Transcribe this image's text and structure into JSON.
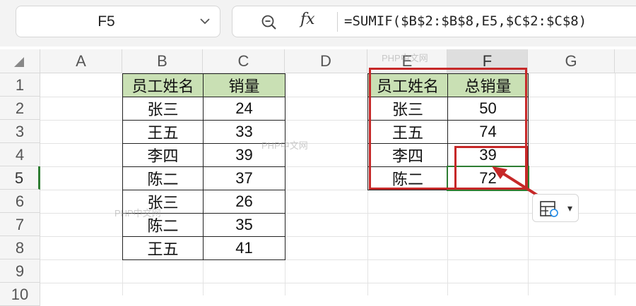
{
  "name_box": {
    "cell_ref": "F5"
  },
  "formula_bar": {
    "fx_label": "fx",
    "formula": "=SUMIF($B$2:$B$8,E5,$C$2:$C$8)"
  },
  "columns": [
    "A",
    "B",
    "C",
    "D",
    "E",
    "F",
    "G"
  ],
  "rows": [
    "1",
    "2",
    "3",
    "4",
    "5",
    "6",
    "7",
    "8",
    "9",
    "10"
  ],
  "selected_cell": "F5",
  "left_table": {
    "headers": [
      "员工姓名",
      "销量"
    ],
    "rows": [
      [
        "张三",
        "24"
      ],
      [
        "王五",
        "33"
      ],
      [
        "李四",
        "39"
      ],
      [
        "陈二",
        "37"
      ],
      [
        "张三",
        "26"
      ],
      [
        "陈二",
        "35"
      ],
      [
        "王五",
        "41"
      ]
    ]
  },
  "right_table": {
    "headers": [
      "员工姓名",
      "总销量"
    ],
    "rows": [
      [
        "张三",
        "50"
      ],
      [
        "王五",
        "74"
      ],
      [
        "李四",
        "39"
      ],
      [
        "陈二",
        "72"
      ]
    ]
  },
  "watermark": "PHP中文网",
  "colors": {
    "header_fill": "#c9e0b4",
    "annotation_red": "#c62828",
    "selection_green": "#2e7d32"
  }
}
